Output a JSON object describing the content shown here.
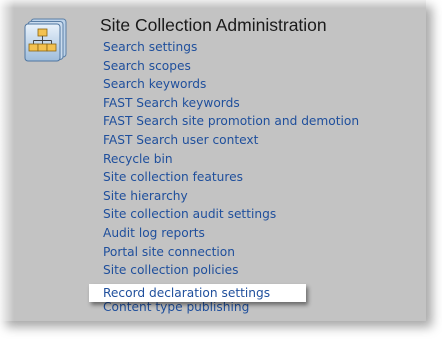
{
  "section": {
    "title": "Site Collection Administration",
    "icon": "site-hierarchy-icon",
    "links": [
      "Search settings",
      "Search scopes",
      "Search keywords",
      "FAST Search keywords",
      "FAST Search site promotion and demotion",
      "FAST Search user context",
      "Recycle bin",
      "Site collection features",
      "Site hierarchy",
      "Site collection audit settings",
      "Audit log reports",
      "Portal site connection",
      "Site collection policies",
      "Record declaration settings",
      "Content type publishing"
    ],
    "highlighted_link": "Record declaration settings"
  },
  "colors": {
    "panel_background": "#c3c3c3",
    "link": "#1f4f9c",
    "heading": "#1a1a1a",
    "highlight_background": "#ffffff"
  }
}
